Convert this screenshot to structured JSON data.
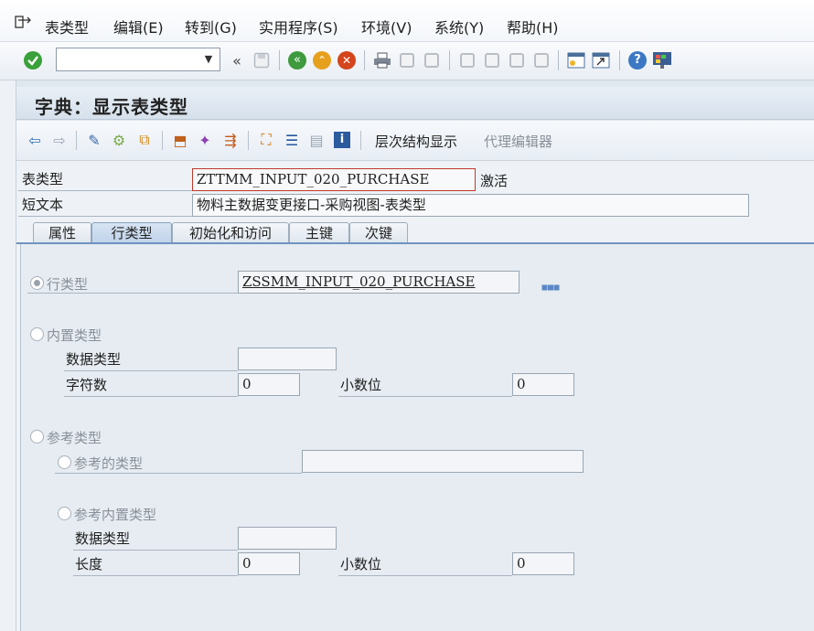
{
  "menu": {
    "items": [
      "表类型",
      "编辑(E)",
      "转到(G)",
      "实用程序(S)",
      "环境(V)",
      "系统(Y)",
      "帮助(H)"
    ]
  },
  "toolbar": {
    "command_value": "",
    "icons": [
      "enter-icon",
      "command-dropdown-icon",
      "collapse-icon",
      "save-icon",
      "back-icon",
      "exit-icon",
      "cancel-icon",
      "print-icon",
      "find-icon",
      "find-next-icon",
      "first-page-icon",
      "prev-page-icon",
      "next-page-icon",
      "last-page-icon",
      "new-session-icon",
      "shortcut-icon",
      "help-icon",
      "customize-layout-icon"
    ]
  },
  "title": "字典：显示表类型",
  "app_toolbar": {
    "hierarchy_label": "层次结构显示",
    "proxy_editor_label": "代理编辑器"
  },
  "header": {
    "table_type_label": "表类型",
    "table_type_value": "ZTTMM_INPUT_020_PURCHASE",
    "status": "激活",
    "short_text_label": "短文本",
    "short_text_value": "物料主数据变更接口-采购视图-表类型"
  },
  "tabs": [
    "属性",
    "行类型",
    "初始化和访问",
    "主键",
    "次键"
  ],
  "active_tab": "行类型",
  "line_type": {
    "row_type_label": "行类型",
    "row_type_value": "ZSSMM_INPUT_020_PURCHASE",
    "builtin_label": "内置类型",
    "data_type_label": "数据类型",
    "data_type_value": "",
    "chars_label": "字符数",
    "chars_value": "0",
    "decimals_label": "小数位",
    "decimals_value": "0",
    "ref_type_label": "参考类型",
    "ref_to_type_label": "参考的类型",
    "ref_to_type_value": "",
    "ref_builtin_label": "参考内置类型",
    "ref_data_type_label": "数据类型",
    "ref_data_type_value": "",
    "length_label": "长度",
    "length_value": "0",
    "ref_decimals_label": "小数位",
    "ref_decimals_value": "0"
  }
}
